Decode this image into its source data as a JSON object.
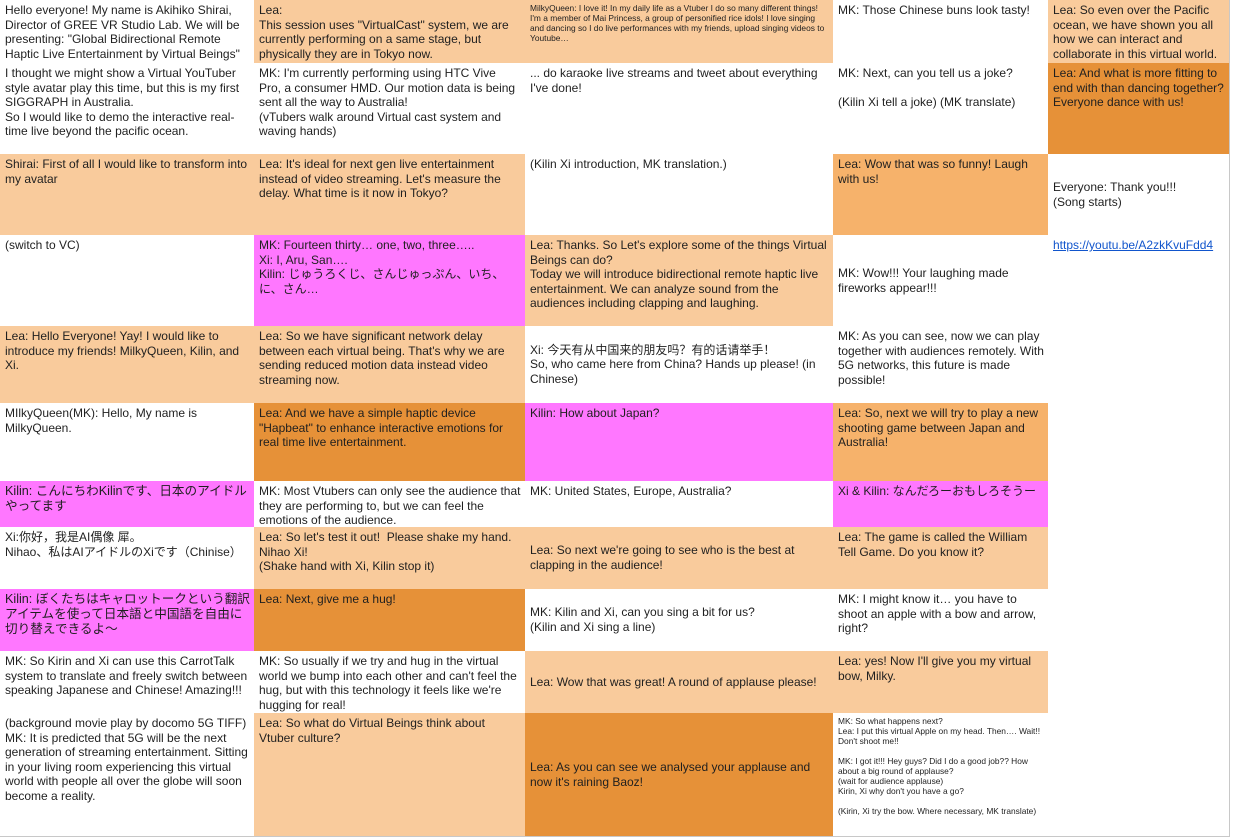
{
  "colors": {
    "peach": "#f9cb9c",
    "orange": "#e69138",
    "light_orange": "#f6b26b",
    "pink": "#ff77ff",
    "white": "#ffffff",
    "link": "#1155cc"
  },
  "columns": [
    {
      "cells": [
        {
          "text": "Hello everyone! My name is Akihiko Shirai, Director of GREE VR Studio Lab. We will be presenting: \"Global Bidirectional Remote Haptic Live Entertainment by Virtual Beings\"",
          "color": "white"
        },
        {
          "text": "I thought we might show a Virtual YouTuber style avatar play this time, but this is my first SIGGRAPH in Australia.\nSo I would like to demo the interactive real-time live beyond the pacific ocean.",
          "color": "white"
        },
        {
          "text": "Shirai: First of all I would like to transform into my avatar",
          "color": "peach"
        },
        {
          "text": "(switch to VC)",
          "color": "white"
        },
        {
          "text": "Lea: Hello Everyone! Yay! I would like to introduce my friends! MilkyQueen, Kilin, and Xi.",
          "color": "peach"
        },
        {
          "text": "MIlkyQueen(MK): Hello, My name is MilkyQueen.",
          "color": "white"
        },
        {
          "text": "Kilin: こんにちわKilinです、日本のアイドルやってます",
          "color": "pink",
          "size": 12.6
        },
        {
          "text": "Xi:你好，我是AI偶像 犀。\nNihao、私はAIアイドルのXiです（Chinise）",
          "color": "white"
        },
        {
          "text": "Kilin: ぼくたちはキャロットークという翻訳アイテムを使って日本語と中国語を自由に切り替えできるよ～",
          "color": "pink",
          "size": 12.6
        },
        {
          "text": "MK: So Kirin and Xi can use this CarrotTalk system to translate and freely switch between speaking Japanese and Chinese! Amazing!!!",
          "color": "white"
        },
        {
          "text": "(background movie play by docomo 5G TIFF)\nMK: It is predicted that 5G will be the next generation of streaming entertainment. Sitting in your living room experiencing this virtual world with people all over the globe will soon become a reality.",
          "color": "white"
        }
      ]
    },
    {
      "cells": [
        {
          "text": "Lea:\nThis session uses \"VirtualCast\" system, we are currently performing on a same stage, but physically they are in Tokyo now.",
          "color": "peach"
        },
        {
          "text": "MK: I'm currently performing using HTC Vive Pro, a consumer HMD. Our motion data is being sent all the way to Australia!\n(vTubers walk around Virtual cast system and waving hands)",
          "color": "white"
        },
        {
          "text": "Lea: It's ideal for next gen live entertainment instead of video streaming. Let's measure the delay. What time is it now in Tokyo?",
          "color": "peach"
        },
        {
          "text": "MK: Fourteen thirty… one, two, three…..\nXi: I, Aru, San….\nKilin: じゅうろくじ、さんじゅっぷん、いち、に、さん…",
          "color": "pink"
        },
        {
          "text": "Lea: So we have significant network delay between each virtual being. That's why we are sending reduced motion data instead video streaming now.",
          "color": "peach"
        },
        {
          "text": "Lea: And we have a simple haptic device \"Hapbeat\" to enhance interactive emotions for real time live entertainment.",
          "color": "orange"
        },
        {
          "text": "MK: Most Vtubers can only see the audience that they are performing to, but we can feel the emotions of the audience.",
          "color": "white"
        },
        {
          "text": "Lea: So let's test it out!  Please shake my hand. Nihao Xi!\n(Shake hand with Xi, Kilin stop it)",
          "color": "peach"
        },
        {
          "text": "Lea: Next, give me a hug!",
          "color": "orange"
        },
        {
          "text": "MK: So usually if we try and hug in the virtual world we bump into each other and can't feel the hug, but with this technology it feels like we're hugging for real!",
          "color": "white"
        },
        {
          "text": "Lea: So what do Virtual Beings think about Vtuber culture?",
          "color": "peach"
        }
      ]
    },
    {
      "cells": [
        {
          "text": "MilkyQueen: I love it! In my daily life as a Vtuber I do so many different things! I'm a member of Mai Princess, a group of personified rice idols! I love singing and dancing so I do live performances with my friends, upload singing videos to Youtube…",
          "color": "peach",
          "small": true
        },
        {
          "text": "... do karaoke live streams and tweet about everything I've done!",
          "color": "white"
        },
        {
          "text": "(Kilin Xi introduction, MK translation.)",
          "color": "white"
        },
        {
          "text": "Lea: Thanks. So Let's explore some of the things Virtual Beings can do?\nToday we will introduce bidirectional remote haptic live entertainment. We can analyze sound from the audiences including clapping and laughing.",
          "color": "peach"
        },
        {
          "text": "Xi: 今天有从中国来的朋友吗？有的话请举手！\nSo, who came here from China? Hands up please! (in Chinese)",
          "color": "white",
          "vmid": true
        },
        {
          "text": "Kilin: How about Japan?",
          "color": "pink"
        },
        {
          "text": "MK: United States, Europe, Australia?",
          "color": "white"
        },
        {
          "text": "Lea: So next we're going to see who is the best at clapping in the audience!",
          "color": "peach",
          "vmid": true
        },
        {
          "text": "MK: Kilin and Xi, can you sing a bit for us?\n(Kilin and Xi sing a line)",
          "color": "white",
          "vmid": true
        },
        {
          "text": "Lea: Wow that was great! A round of applause please!",
          "color": "peach",
          "vmid": true
        },
        {
          "text": "Lea: As you can see we analysed your applause and now it's raining Baoz!",
          "color": "orange",
          "vmid": true
        }
      ]
    },
    {
      "cells": [
        {
          "text": "MK: Those Chinese buns look tasty!",
          "color": "white"
        },
        {
          "text": "MK: Next, can you tell us a joke?\n\n(Kilin Xi tell a joke) (MK translate)",
          "color": "white"
        },
        {
          "text": "Lea: Wow that was so funny! Laugh with us!",
          "color": "light_orange"
        },
        {
          "text": "MK: Wow!!! Your laughing made fireworks appear!!!",
          "color": "white",
          "vmid": true
        },
        {
          "text": "MK: As you can see, now we can play together with audiences remotely. With 5G networks, this future is made possible!",
          "color": "white"
        },
        {
          "text": "Lea: So, next we will try to play a new shooting game between Japan and Australia!",
          "color": "light_orange"
        },
        {
          "text": "Xi & Kilin: なんだろーおもしろそうー",
          "color": "pink"
        },
        {
          "text": "Lea: The game is called the William Tell Game. Do you know it?",
          "color": "peach"
        },
        {
          "text": "MK: I might know it… you have to shoot an apple with a bow and arrow, right?",
          "color": "white"
        },
        {
          "text": "Lea: yes! Now I'll give you my virtual bow, Milky.",
          "color": "peach"
        },
        {
          "text": "MK: So what happens next?\nLea: I put this virtual Apple on my head. Then…. Wait!! Don't shoot me!!\n\nMK: I got it!!! Hey guys? Did I do a good job?? How about a big round of applause?\n(wait for audience applause)\nKirin, Xi why don't you have a go?\n\n(Kirin, Xi try the bow. Where necessary, MK translate)",
          "color": "white",
          "small": true
        }
      ]
    },
    {
      "cells": [
        {
          "text": "Lea: So even over the Pacific ocean, we have shown you all how we can interact and collaborate in this virtual world.",
          "color": "peach"
        },
        {
          "text": "Lea: And what is more fitting to end with than dancing together? Everyone dance with us!",
          "color": "orange"
        },
        {
          "text": "Everyone: Thank you!!!\n(Song starts)",
          "color": "white",
          "vmid": true
        },
        {
          "text": "https://youtu.be/A2zkKvuFdd4",
          "color": "white",
          "link": true
        },
        {
          "text": "",
          "color": "white"
        },
        {
          "text": "",
          "color": "white"
        },
        {
          "text": "",
          "color": "white"
        },
        {
          "text": "",
          "color": "white"
        },
        {
          "text": "",
          "color": "white"
        },
        {
          "text": "",
          "color": "white"
        },
        {
          "text": "",
          "color": "white"
        }
      ]
    }
  ]
}
